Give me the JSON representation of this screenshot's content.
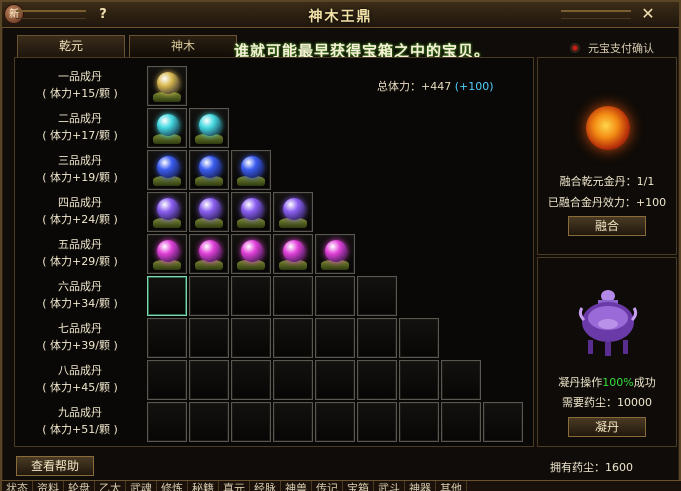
{
  "window": {
    "title": "神木王鼎",
    "help_label": "?",
    "close_label": "✕",
    "badge_label": "新"
  },
  "tabs": [
    {
      "label": "乾元"
    },
    {
      "label": "神木"
    }
  ],
  "marquee": "谁就可能最早获得宝箱之中的宝贝。",
  "payment_option": "元宝支付确认",
  "total_power": {
    "label": "总体力：+447",
    "bonus": "(+100)"
  },
  "tiers": [
    {
      "name": "一品成丹",
      "stat": "( 体力+15/颗 )",
      "filled": 1,
      "slots": 1,
      "color": "gold"
    },
    {
      "name": "二品成丹",
      "stat": "( 体力+17/颗 )",
      "filled": 2,
      "slots": 2,
      "color": "cyan"
    },
    {
      "name": "三品成丹",
      "stat": "( 体力+19/颗 )",
      "filled": 3,
      "slots": 3,
      "color": "blue"
    },
    {
      "name": "四品成丹",
      "stat": "( 体力+24/颗 )",
      "filled": 4,
      "slots": 4,
      "color": "violet"
    },
    {
      "name": "五品成丹",
      "stat": "( 体力+29/颗 )",
      "filled": 5,
      "slots": 5,
      "color": "magenta"
    },
    {
      "name": "六品成丹",
      "stat": "( 体力+34/颗 )",
      "filled": 0,
      "slots": 6,
      "color": "none"
    },
    {
      "name": "七品成丹",
      "stat": "( 体力+39/颗 )",
      "filled": 0,
      "slots": 7,
      "color": "none"
    },
    {
      "name": "八品成丹",
      "stat": "( 体力+45/颗 )",
      "filled": 0,
      "slots": 8,
      "color": "none"
    },
    {
      "name": "九品成丹",
      "stat": "( 体力+51/颗 )",
      "filled": 0,
      "slots": 9,
      "color": "none"
    }
  ],
  "fusion": {
    "golden_pill_count": "融合乾元金丹：1/1",
    "pill_effect": "已融合金丹效力：+100",
    "button_label": "融合"
  },
  "condense": {
    "rate_prefix": "凝丹操作",
    "rate_value": "100%",
    "rate_suffix": "成功",
    "required_dust": "需要药尘：10000",
    "button_label": "凝丹"
  },
  "help_button_label": "查看帮助",
  "owned_dust": "拥有药尘：1600",
  "bottom_tabs": [
    "状态",
    "资料",
    "轮盘",
    "乙太",
    "武魂",
    "修炼",
    "秘籍",
    "真元",
    "经脉",
    "神兽",
    "传记",
    "宝箱",
    "武斗",
    "神器",
    "其他"
  ],
  "colors": {
    "gold": "#d8b850",
    "cyan": "#44d8e0",
    "blue": "#3a5cf0",
    "violet": "#8a5ef0",
    "magenta": "#e040d8"
  }
}
